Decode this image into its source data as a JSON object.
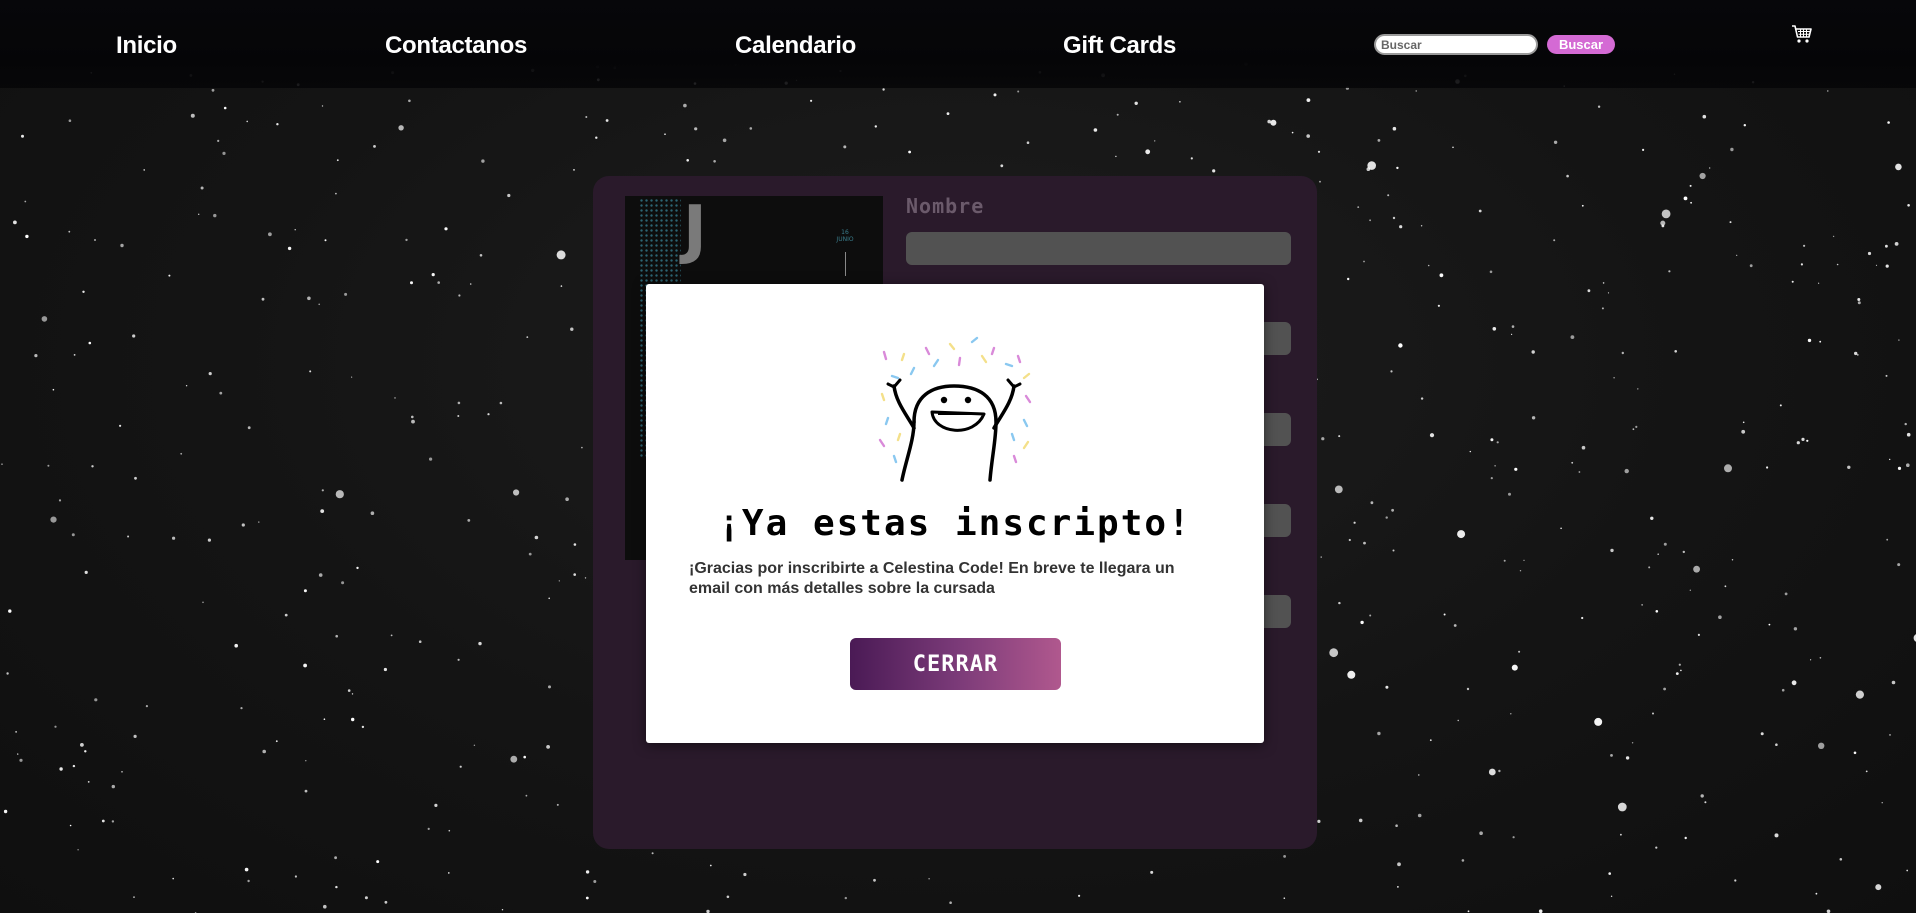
{
  "navbar": {
    "links": [
      {
        "label": "Inicio"
      },
      {
        "label": "Contactanos"
      },
      {
        "label": "Calendario"
      },
      {
        "label": "Gift Cards"
      }
    ],
    "search": {
      "placeholder": "Buscar",
      "value": "",
      "button_label": "Buscar"
    },
    "cart_icon": "shopping-cart-icon"
  },
  "form": {
    "poster": {
      "letter": "J",
      "date_text": "16\nJUNIO"
    },
    "first_field_label": "Nombre"
  },
  "modal": {
    "illustration": "celebrating-flork-icon",
    "title": "¡Ya estas inscripto!",
    "message": "¡Gracias por inscribirte a Celestina Code! En breve te llegara un email con más detalles sobre la cursada",
    "close_label": "CERRAR"
  },
  "colors": {
    "navbar_bg": "#050507",
    "search_button": "#d46ad4",
    "form_card_bg": "#2a1a2b",
    "close_gradient_start": "#4a1a55",
    "close_gradient_end": "#b0588e"
  }
}
